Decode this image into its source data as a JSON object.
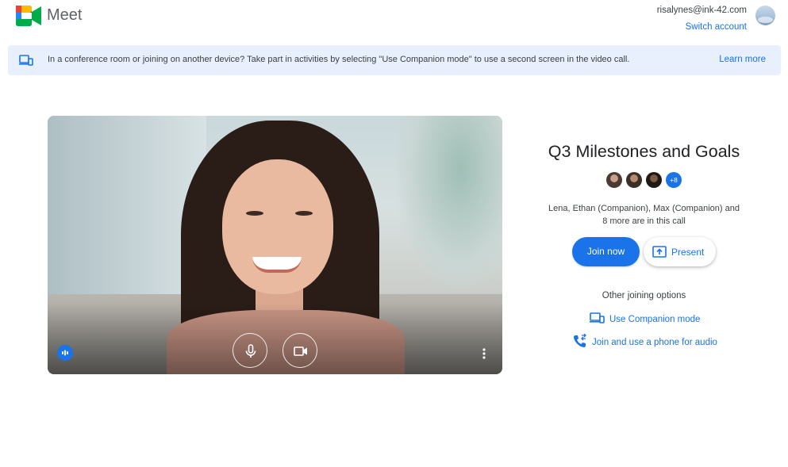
{
  "app": {
    "name": "Meet",
    "icon": "google-meet-logo-icon"
  },
  "account": {
    "email": "risalynes@ink-42.com",
    "switch_label": "Switch account"
  },
  "banner": {
    "icon": "companion-devices-icon",
    "text": "In a conference room or joining on another device? Take part in activities by selecting \"Use Companion mode\" to use a second screen in the video call.",
    "link_label": "Learn more"
  },
  "video": {
    "controls": [
      {
        "name": "microphone-button",
        "icon": "microphone-icon"
      },
      {
        "name": "camera-button",
        "icon": "video-camera-icon"
      }
    ],
    "audio_indicator_icon": "audio-level-icon",
    "more_icon": "more-vert-icon"
  },
  "meeting": {
    "title": "Q3 Milestones and Goals",
    "extra_participants_badge": "+8",
    "in_call_line1": "Lena, Ethan (Companion), Max (Companion) and",
    "in_call_line2": "8 more are in this call",
    "join_label": "Join now",
    "present_label": "Present",
    "other_options_label": "Other joining options",
    "companion_label": "Use Companion mode",
    "phone_label": "Join and use a phone for audio"
  },
  "colors": {
    "accent": "#1a73e8",
    "banner_bg": "#e8f0fe",
    "text": "#202124"
  }
}
